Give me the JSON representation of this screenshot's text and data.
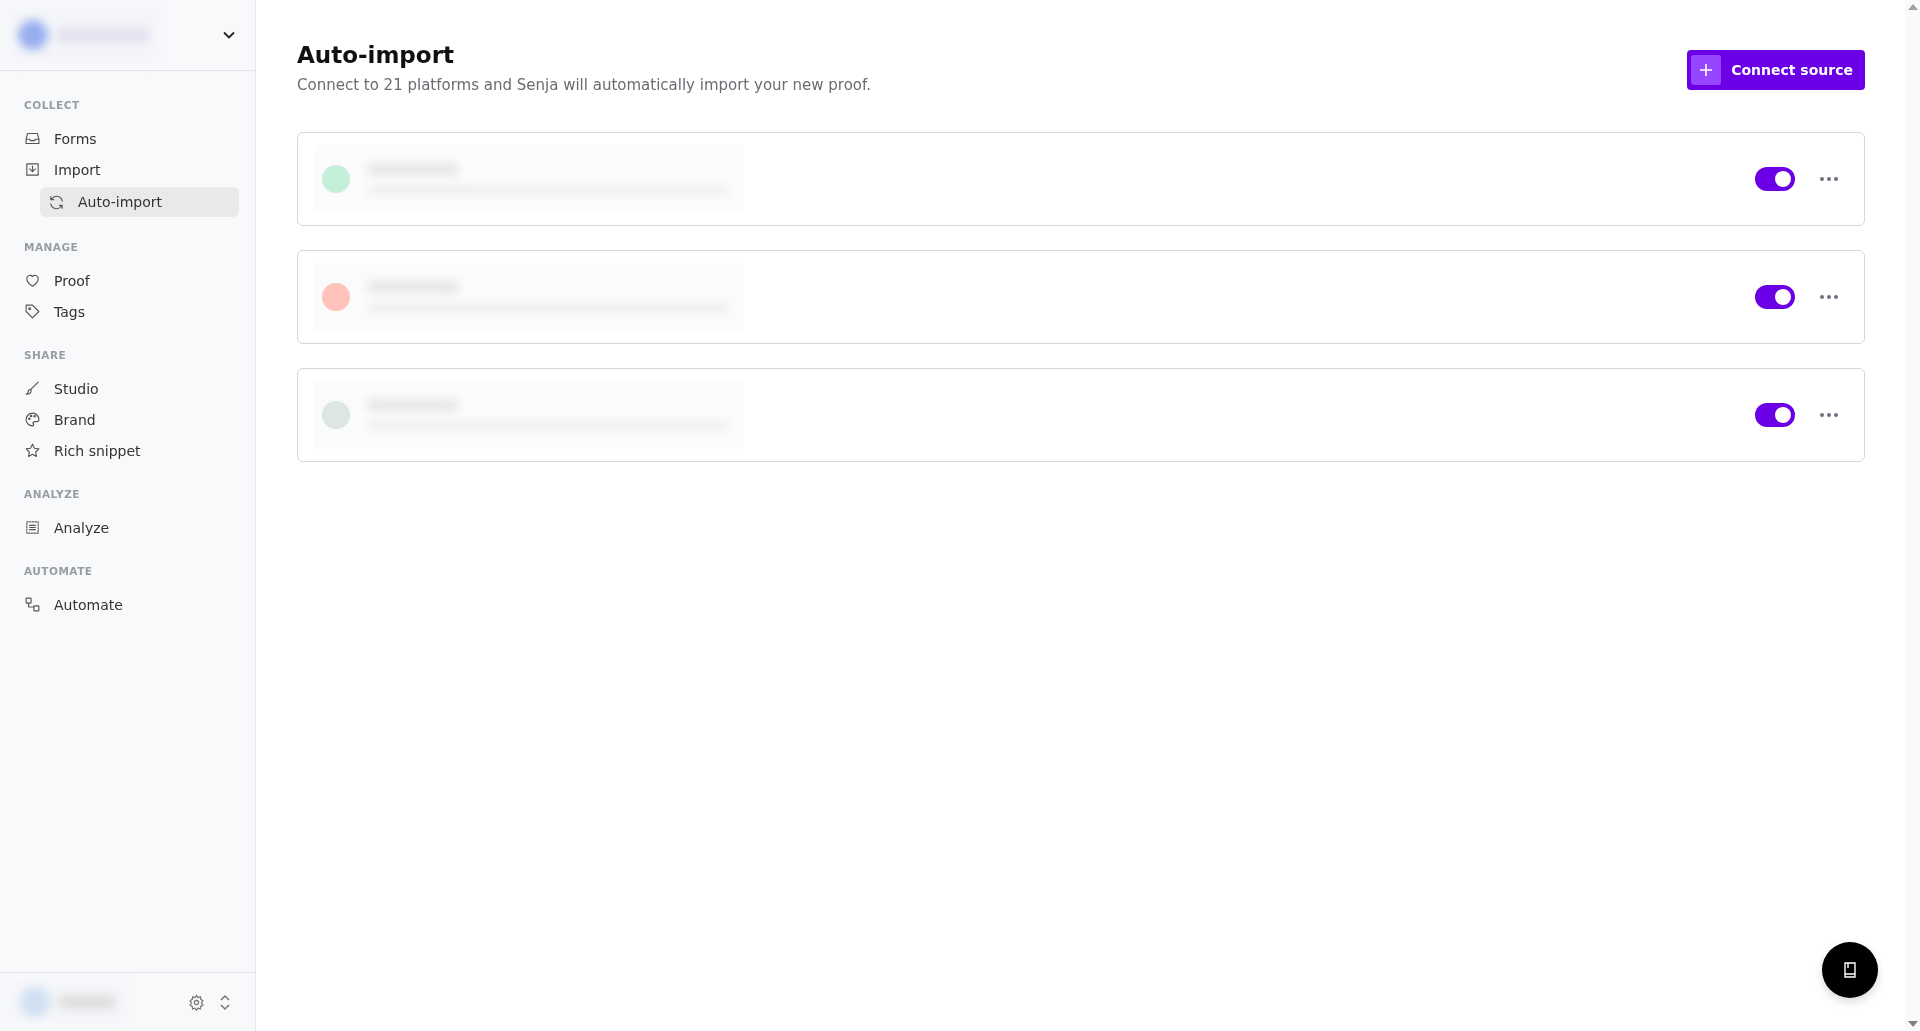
{
  "sidebar": {
    "sections": [
      {
        "label": "COLLECT",
        "items": [
          {
            "label": "Forms",
            "selected": false
          },
          {
            "label": "Import",
            "selected": false,
            "children": [
              {
                "label": "Auto-import",
                "selected": true
              }
            ]
          }
        ]
      },
      {
        "label": "MANAGE",
        "items": [
          {
            "label": "Proof",
            "selected": false
          },
          {
            "label": "Tags",
            "selected": false
          }
        ]
      },
      {
        "label": "SHARE",
        "items": [
          {
            "label": "Studio",
            "selected": false
          },
          {
            "label": "Brand",
            "selected": false
          },
          {
            "label": "Rich snippet",
            "selected": false
          }
        ]
      },
      {
        "label": "ANALYZE",
        "items": [
          {
            "label": "Analyze",
            "selected": false
          }
        ]
      },
      {
        "label": "AUTOMATE",
        "items": [
          {
            "label": "Automate",
            "selected": false
          }
        ]
      }
    ]
  },
  "header": {
    "title": "Auto-import",
    "subtitle": "Connect to 21 platforms and Senja will automatically import your new proof.",
    "button": "Connect source"
  },
  "sources": [
    {
      "color": "#c4efd9",
      "on": true
    },
    {
      "color": "#ffc3bb",
      "on": true
    },
    {
      "color": "#dde5e5",
      "on": true
    }
  ]
}
